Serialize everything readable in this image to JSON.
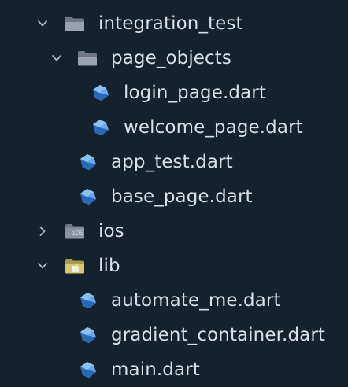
{
  "tree": {
    "integration_test": {
      "label": "integration_test",
      "expanded": true
    },
    "page_objects": {
      "label": "page_objects",
      "expanded": true
    },
    "login_page": {
      "label": "login_page.dart"
    },
    "welcome_page": {
      "label": "welcome_page.dart"
    },
    "app_test": {
      "label": "app_test.dart"
    },
    "base_page": {
      "label": "base_page.dart"
    },
    "ios": {
      "label": "ios",
      "expanded": false,
      "badge": "iOS"
    },
    "lib": {
      "label": "lib",
      "expanded": true
    },
    "automate_me": {
      "label": "automate_me.dart"
    },
    "gradient_container": {
      "label": "gradient_container.dart"
    },
    "main": {
      "label": "main.dart"
    }
  },
  "colors": {
    "background": "#13222d",
    "text": "#d9dfe5",
    "chevron": "#aeb7bf",
    "folder": "#8d96a0",
    "lib_folder": "#cfc16a",
    "dart_dark": "#2a68b8",
    "dart_light": "#6aa7e6"
  }
}
